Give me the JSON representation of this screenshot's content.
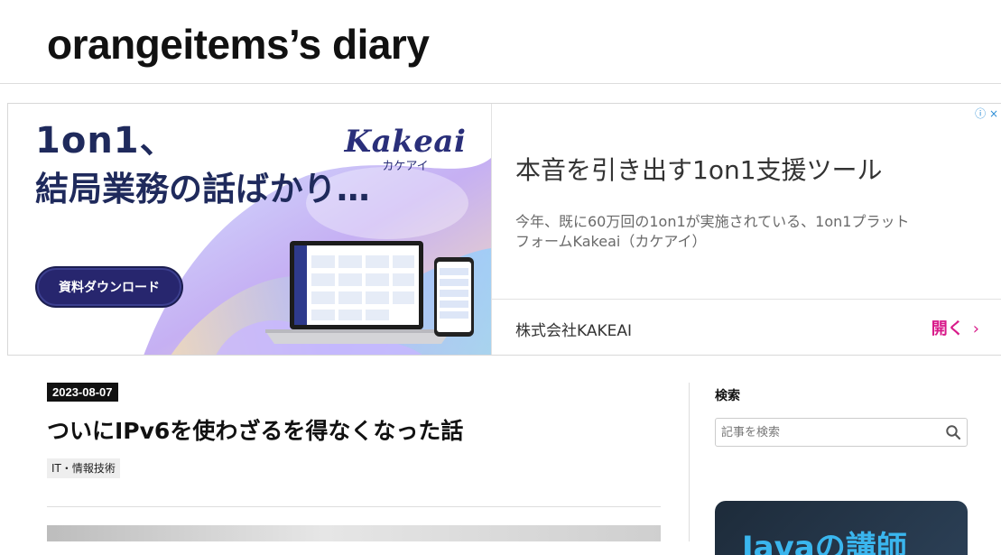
{
  "site": {
    "title": "orangeitems’s diary"
  },
  "ad": {
    "image_headline_line1": "1on1、",
    "image_headline_line2": "結局業務の話ばかり…",
    "brand_name": "Kakeai",
    "brand_kana": "カケアイ",
    "download_button": "資料ダウンロード",
    "title": "本音を引き出す1on1支援ツール",
    "description": "今年、既に60万回の1on1が実施されている、1on1プラットフォームKakeai（カケアイ）",
    "company": "株式会社KAKEAI",
    "open_label": "開く",
    "open_chevron": "›",
    "info_icon": "ⓘ",
    "close_icon": "×",
    "colors": {
      "accent_pink": "#d81b8a",
      "navy": "#1f2a5c",
      "info_blue": "#2f8fd6"
    }
  },
  "article": {
    "date": "2023-08-07",
    "title": "ついにIPv6を使わざるを得なくなった話",
    "category": "IT・情報技術"
  },
  "sidebar": {
    "search_heading": "検索",
    "search_placeholder": "記事を検索",
    "search_icon": "search-icon",
    "promo_text": "Javaの講師"
  }
}
